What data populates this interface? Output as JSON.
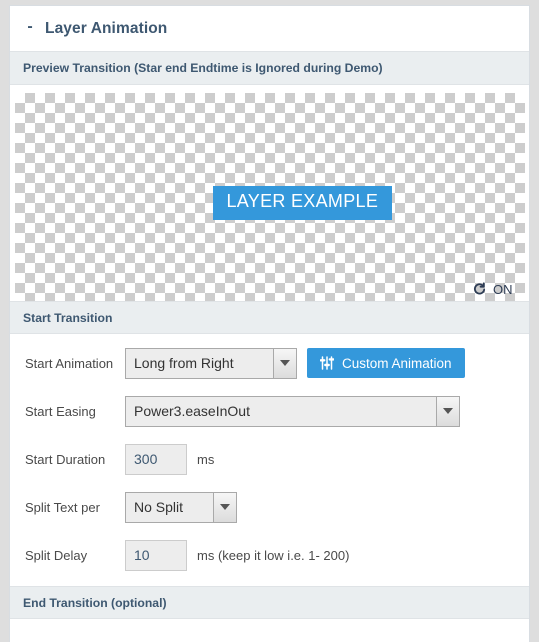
{
  "panel": {
    "collapse_toggle": "-",
    "title": "Layer Animation"
  },
  "preview_section": {
    "bar_label": "Preview Transition (Star end Endtime is Ignored during Demo)",
    "example_button_label": "LAYER EXAMPLE",
    "loop_icon": "loop-refresh-icon",
    "loop_state_label": "ON"
  },
  "start_transition": {
    "bar_label": "Start Transition",
    "fields": {
      "start_animation": {
        "label": "Start Animation",
        "value": "Long from Right",
        "options": [
          "Long from Right"
        ]
      },
      "custom_animation_button": {
        "label": "Custom Animation",
        "icon": "sliders-icon"
      },
      "start_easing": {
        "label": "Start Easing",
        "value": "Power3.easeInOut",
        "options": [
          "Power3.easeInOut"
        ]
      },
      "start_duration": {
        "label": "Start Duration",
        "value": "300",
        "unit": "ms"
      },
      "split_text_per": {
        "label": "Split Text per",
        "value": "No Split",
        "options": [
          "No Split"
        ]
      },
      "split_delay": {
        "label": "Split Delay",
        "value": "10",
        "unit": "ms (keep it low i.e. 1- 200)"
      }
    }
  },
  "end_transition": {
    "bar_label": "End Transition (optional)"
  },
  "colors": {
    "accent_blue": "#3498db",
    "heading_navy": "#3e5871",
    "section_bar_bg": "#eaeef0",
    "page_bg": "#dedede"
  }
}
